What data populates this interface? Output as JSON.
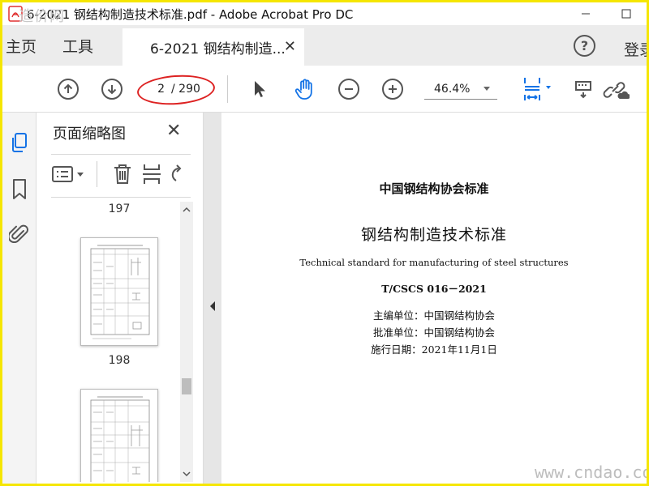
{
  "window": {
    "title": "6-2021 钢结构制造技术标准.pdf - Adobe Acrobat Pro DC",
    "watermark_logo": "造价网"
  },
  "tabs": {
    "home": "主页",
    "tools": "工具",
    "document": "6-2021 钢结构制造...",
    "login": "登录"
  },
  "toolbar": {
    "current_page": "2",
    "total_pages": "/ 290",
    "zoom": "46.4%"
  },
  "panel": {
    "title": "页面缩略图",
    "thumbnails": [
      {
        "label": "197"
      },
      {
        "label": "198"
      }
    ]
  },
  "document": {
    "org_heading": "中国钢结构协会标准",
    "title_cn": "钢结构制造技术标准",
    "title_en": "Technical standard for manufacturing of steel structures",
    "code": "T/CSCS 016－2021",
    "editor": "主编单位：中国钢结构协会",
    "approver": "批准单位：中国钢结构协会",
    "effective": "施行日期：2021年11月1日"
  },
  "watermark": "www.cndao.com",
  "colors": {
    "accent_blue": "#1473e6",
    "annotation_red": "#d22222",
    "border_yellow": "#f5e600"
  }
}
